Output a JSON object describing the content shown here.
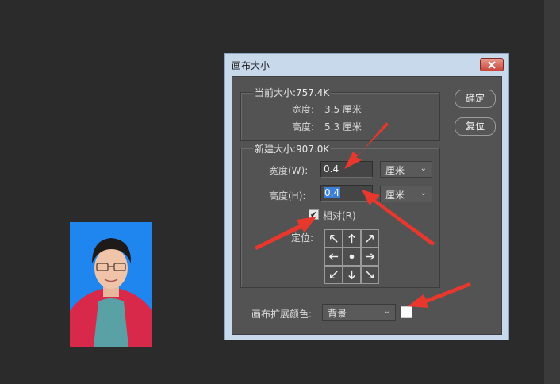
{
  "dialog": {
    "title": "画布大小",
    "ok_label": "确定",
    "reset_label": "复位",
    "current_size": {
      "title": "当前大小:757.4K",
      "width_label": "宽度:",
      "width_value": "3.5 厘米",
      "height_label": "高度:",
      "height_value": "5.3 厘米"
    },
    "new_size": {
      "title": "新建大小:907.0K",
      "width_label": "宽度(W):",
      "width_value": "0.4",
      "width_unit": "厘米",
      "height_label": "高度(H):",
      "height_value": "0.4",
      "height_unit": "厘米",
      "relative_label": "相对(R)",
      "relative_checked": true,
      "anchor_label": "定位:"
    },
    "extension_color": {
      "label": "画布扩展颜色:",
      "value": "背景",
      "swatch_color": "#ffffff"
    }
  },
  "annotation_color": "#e8382d"
}
